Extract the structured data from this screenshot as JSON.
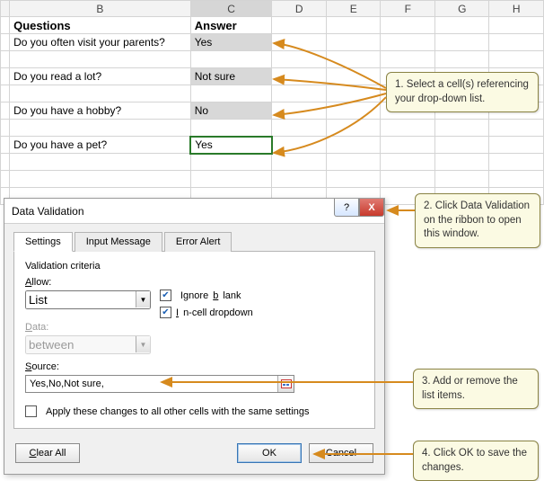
{
  "columns": [
    "B",
    "C",
    "D",
    "E",
    "F",
    "G",
    "H"
  ],
  "header_questions": "Questions",
  "header_answer": "Answer",
  "rows": [
    {
      "q": "Do you often visit your parents?",
      "a": "Yes"
    },
    {
      "q": "Do you read a lot?",
      "a": "Not sure"
    },
    {
      "q": "Do you have a hobby?",
      "a": "No"
    },
    {
      "q": "Do you have a pet?",
      "a": "Yes"
    }
  ],
  "dialog": {
    "title": "Data Validation",
    "tabs": {
      "settings": "Settings",
      "input_message": "Input Message",
      "error_alert": "Error Alert"
    },
    "criteria_label": "Validation criteria",
    "allow_label": "Allow:",
    "allow_value": "List",
    "ignore_blank": "Ignore blank",
    "incell_dropdown": "In-cell dropdown",
    "data_label": "Data:",
    "data_value": "between",
    "source_label": "Source:",
    "source_value": "Yes,No,Not sure,",
    "apply_all": "Apply these changes to all other cells with the same settings",
    "clear_all": "Clear All",
    "ok": "OK",
    "cancel": "Cancel",
    "help_char": "?",
    "close_char": "X"
  },
  "callouts": {
    "c1": "1. Select a cell(s)  referencing your drop-down list.",
    "c2": "2. Click Data Validation on the ribbon to open this window.",
    "c3": "3. Add or remove the list items.",
    "c4": "4. Click OK to save the changes."
  }
}
